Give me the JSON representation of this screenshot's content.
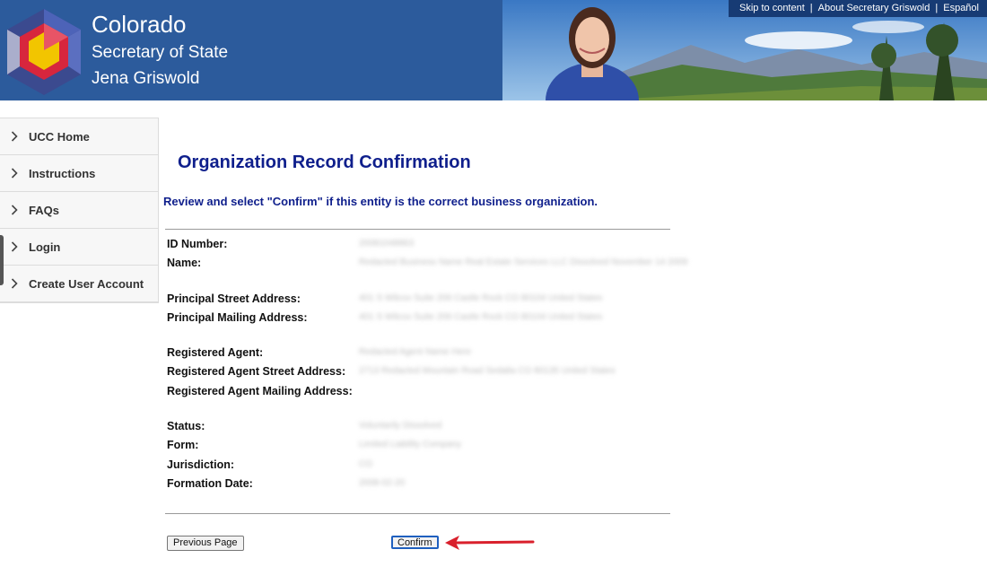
{
  "header": {
    "state": "Colorado",
    "office": "Secretary of State",
    "official": "Jena Griswold",
    "links": [
      "Skip to content",
      "About Secretary Griswold",
      "Español"
    ]
  },
  "sidebar": {
    "items": [
      {
        "label": "UCC Home"
      },
      {
        "label": "Instructions"
      },
      {
        "label": "FAQs"
      },
      {
        "label": "Login"
      },
      {
        "label": "Create User Account"
      }
    ]
  },
  "main": {
    "title": "Organization Record Confirmation",
    "instruction": "Review and select \"Confirm\" if this entity is the correct business organization.",
    "fields": [
      {
        "label": "ID Number:",
        "value": "20081048863"
      },
      {
        "label": "Name:",
        "value": "Redacted Business Name Real Estate Services LLC Dissolved November 14 2009"
      },
      {
        "label": "Principal Street Address:",
        "value": "401 S Wilcox Suite 206 Castle Rock CO 80104 United States"
      },
      {
        "label": "Principal Mailing Address:",
        "value": "401 S Wilcox Suite 206 Castle Rock CO 80104 United States"
      },
      {
        "label": "Registered Agent:",
        "value": "Redacted Agent Name Here"
      },
      {
        "label": "Registered Agent Street Address:",
        "value": "2713 Redacted Mountain Road Sedalia CO 80135 United States"
      },
      {
        "label": "Registered Agent Mailing Address:",
        "value": ""
      },
      {
        "label": "Status:",
        "value": "Voluntarily Dissolved"
      },
      {
        "label": "Form:",
        "value": "Limited Liability Company"
      },
      {
        "label": "Jurisdiction:",
        "value": "CO"
      },
      {
        "label": "Formation Date:",
        "value": "2008-02-20"
      }
    ]
  },
  "buttons": {
    "previous": "Previous Page",
    "confirm": "Confirm"
  },
  "colors": {
    "banner": "#2c5b9c",
    "title": "#0f1f8c",
    "arrow": "#d9202c"
  }
}
